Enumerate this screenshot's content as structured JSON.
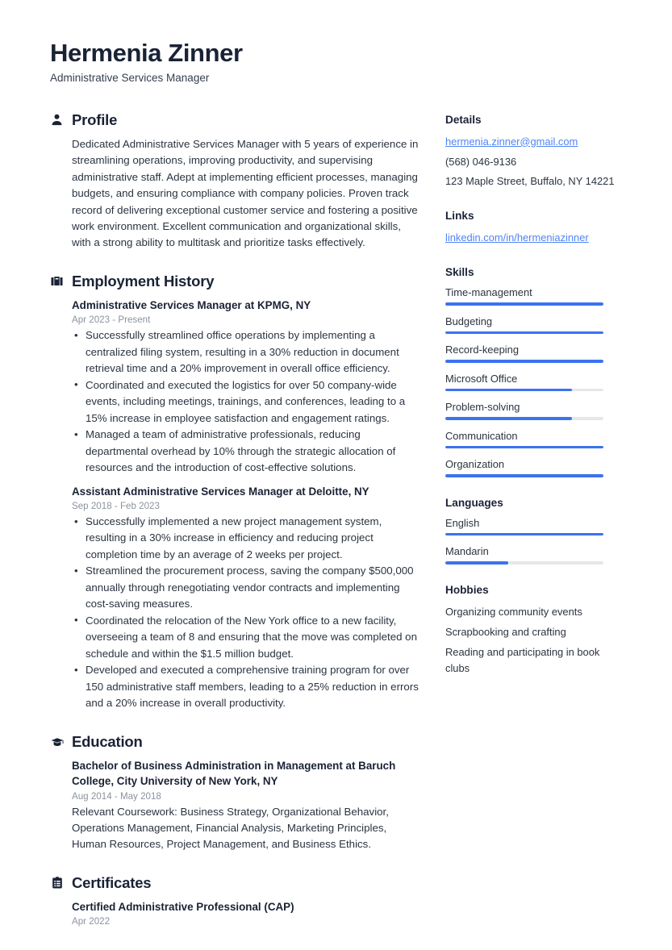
{
  "header": {
    "name": "Hermenia Zinner",
    "job_title": "Administrative Services Manager"
  },
  "profile": {
    "icon": "user-icon",
    "title": "Profile",
    "text": "Dedicated Administrative Services Manager with 5 years of experience in streamlining operations, improving productivity, and supervising administrative staff. Adept at implementing efficient processes, managing budgets, and ensuring compliance with company policies. Proven track record of delivering exceptional customer service and fostering a positive work environment. Excellent communication and organizational skills, with a strong ability to multitask and prioritize tasks effectively."
  },
  "employment": {
    "icon": "briefcase-icon",
    "title": "Employment History",
    "entries": [
      {
        "title": "Administrative Services Manager at KPMG, NY",
        "date": "Apr 2023 - Present",
        "bullets": [
          "Successfully streamlined office operations by implementing a centralized filing system, resulting in a 30% reduction in document retrieval time and a 20% improvement in overall office efficiency.",
          "Coordinated and executed the logistics for over 50 company-wide events, including meetings, trainings, and conferences, leading to a 15% increase in employee satisfaction and engagement ratings.",
          "Managed a team of administrative professionals, reducing departmental overhead by 10% through the strategic allocation of resources and the introduction of cost-effective solutions."
        ]
      },
      {
        "title": "Assistant Administrative Services Manager at Deloitte, NY",
        "date": "Sep 2018 - Feb 2023",
        "bullets": [
          "Successfully implemented a new project management system, resulting in a 30% increase in efficiency and reducing project completion time by an average of 2 weeks per project.",
          "Streamlined the procurement process, saving the company $500,000 annually through renegotiating vendor contracts and implementing cost-saving measures.",
          "Coordinated the relocation of the New York office to a new facility, overseeing a team of 8 and ensuring that the move was completed on schedule and within the $1.5 million budget.",
          "Developed and executed a comprehensive training program for over 150 administrative staff members, leading to a 25% reduction in errors and a 20% increase in overall productivity."
        ]
      }
    ]
  },
  "education": {
    "icon": "graduation-cap-icon",
    "title": "Education",
    "entries": [
      {
        "title": "Bachelor of Business Administration in Management at Baruch College, City University of New York, NY",
        "date": "Aug 2014 - May 2018",
        "description": "Relevant Coursework: Business Strategy, Organizational Behavior, Operations Management, Financial Analysis, Marketing Principles, Human Resources, Project Management, and Business Ethics."
      }
    ]
  },
  "certificates": {
    "icon": "clipboard-icon",
    "title": "Certificates",
    "entries": [
      {
        "title": "Certified Administrative Professional (CAP)",
        "date": "Apr 2022"
      }
    ]
  },
  "details": {
    "title": "Details",
    "email": "hermenia.zinner@gmail.com",
    "phone": "(568) 046-9136",
    "address": "123 Maple Street, Buffalo, NY 14221"
  },
  "links": {
    "title": "Links",
    "items": [
      {
        "label": "linkedin.com/in/hermeniazinner"
      }
    ]
  },
  "skills": {
    "title": "Skills",
    "items": [
      {
        "label": "Time-management",
        "level": 100
      },
      {
        "label": "Budgeting",
        "level": 100
      },
      {
        "label": "Record-keeping",
        "level": 100
      },
      {
        "label": "Microsoft Office",
        "level": 80
      },
      {
        "label": "Problem-solving",
        "level": 80
      },
      {
        "label": "Communication",
        "level": 100
      },
      {
        "label": "Organization",
        "level": 100
      }
    ]
  },
  "languages": {
    "title": "Languages",
    "items": [
      {
        "label": "English",
        "level": 100
      },
      {
        "label": "Mandarin",
        "level": 40
      }
    ]
  },
  "hobbies": {
    "title": "Hobbies",
    "items": [
      "Organizing community events",
      "Scrapbooking and crafting",
      "Reading and participating in book clubs"
    ]
  },
  "theme": {
    "accent": "#3b72f0",
    "link": "#4f84f5",
    "heading": "#1a2235",
    "text": "#2b3440",
    "muted": "#8b939e",
    "track": "#e6e7e9"
  }
}
